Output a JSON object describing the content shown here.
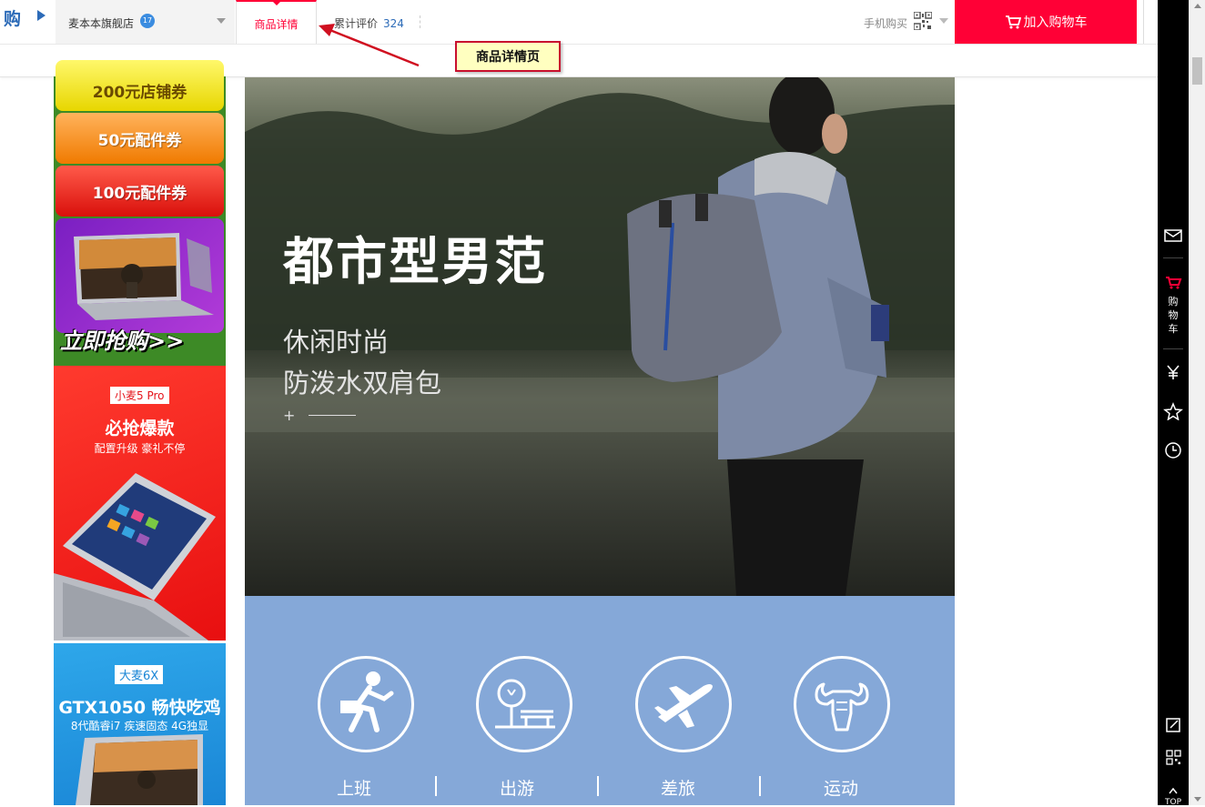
{
  "topbar": {
    "logo_glyph": "购",
    "shop_name": "麦本本旗舰店",
    "shop_badge": "17",
    "tab_detail": "商品详情",
    "tab_reviews": "累计评价",
    "review_count": "324",
    "mobile_buy": "手机购买",
    "add_to_cart": "加入购物车",
    "accent_color": "#ff0036"
  },
  "callout": {
    "text": "商品详情页"
  },
  "sidebar": {
    "coupons": [
      "200元店铺券",
      "50元配件券",
      "100元配件券"
    ],
    "promo1_cta": "立即抢购>>",
    "promo2": {
      "tag": "小麦5 Pro",
      "title": "必抢爆款",
      "subtitle": "配置升级 豪礼不停"
    },
    "promo3": {
      "tag": "大麦6X",
      "title": "GTX1050 畅快吃鸡",
      "subtitle": "8代酷睿i7 疾速固态 4G独显"
    }
  },
  "hero": {
    "headline": "都市型男范",
    "line1": "休闲时尚",
    "line2": "防泼水双肩包",
    "plus": "+"
  },
  "scenes": [
    {
      "label": "上班",
      "icon": "commute-icon"
    },
    {
      "label": "出游",
      "icon": "park-bench-icon"
    },
    {
      "label": "差旅",
      "icon": "airplane-icon"
    },
    {
      "label": "运动",
      "icon": "muscle-icon"
    }
  ],
  "toolbar": {
    "cart_text": [
      "购",
      "物",
      "车"
    ],
    "top_label": "TOP"
  }
}
